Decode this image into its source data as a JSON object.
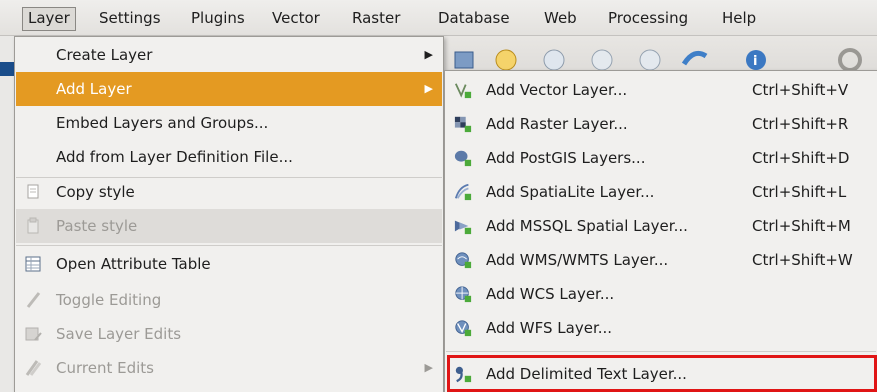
{
  "menubar": {
    "items": [
      "Layer",
      "Settings",
      "Plugins",
      "Vector",
      "Raster",
      "Database",
      "Web",
      "Processing",
      "Help"
    ],
    "active": "Layer"
  },
  "layer_menu": {
    "items": [
      {
        "label": "Create Layer",
        "submenu": true
      },
      {
        "label": "Add Layer",
        "submenu": true,
        "highlighted": true
      },
      {
        "label": "Embed Layers and Groups..."
      },
      {
        "label": "Add from Layer Definition File..."
      },
      {
        "label": "Copy style",
        "icon": "copy-style-icon"
      },
      {
        "label": "Paste style",
        "icon": "paste-style-icon",
        "disabled": true
      },
      {
        "label": "Open Attribute Table",
        "icon": "attribute-table-icon"
      },
      {
        "label": "Toggle Editing",
        "icon": "pencil-icon",
        "disabled": true
      },
      {
        "label": "Save Layer Edits",
        "icon": "save-edits-icon",
        "disabled": true
      },
      {
        "label": "Current Edits",
        "icon": "current-edits-icon",
        "disabled": true,
        "submenu": true
      }
    ]
  },
  "add_layer_submenu": {
    "items": [
      {
        "label": "Add Vector Layer...",
        "shortcut": "Ctrl+Shift+V",
        "icon": "vector-layer-icon"
      },
      {
        "label": "Add Raster Layer...",
        "shortcut": "Ctrl+Shift+R",
        "icon": "raster-layer-icon"
      },
      {
        "label": "Add PostGIS Layers...",
        "shortcut": "Ctrl+Shift+D",
        "icon": "postgis-icon"
      },
      {
        "label": "Add SpatiaLite Layer...",
        "shortcut": "Ctrl+Shift+L",
        "icon": "spatialite-icon"
      },
      {
        "label": "Add MSSQL Spatial Layer...",
        "shortcut": "Ctrl+Shift+M",
        "icon": "mssql-icon"
      },
      {
        "label": "Add WMS/WMTS Layer...",
        "shortcut": "Ctrl+Shift+W",
        "icon": "wms-icon"
      },
      {
        "label": "Add WCS Layer...",
        "shortcut": "",
        "icon": "wcs-icon"
      },
      {
        "label": "Add WFS Layer...",
        "shortcut": "",
        "icon": "wfs-icon"
      },
      {
        "label": "Add Delimited Text Layer...",
        "shortcut": "",
        "icon": "delimited-text-icon",
        "boxed": true
      }
    ]
  },
  "colors": {
    "highlight": "#e49a22",
    "focus_box": "#e01515",
    "menu_bg": "#f1f0ee"
  }
}
